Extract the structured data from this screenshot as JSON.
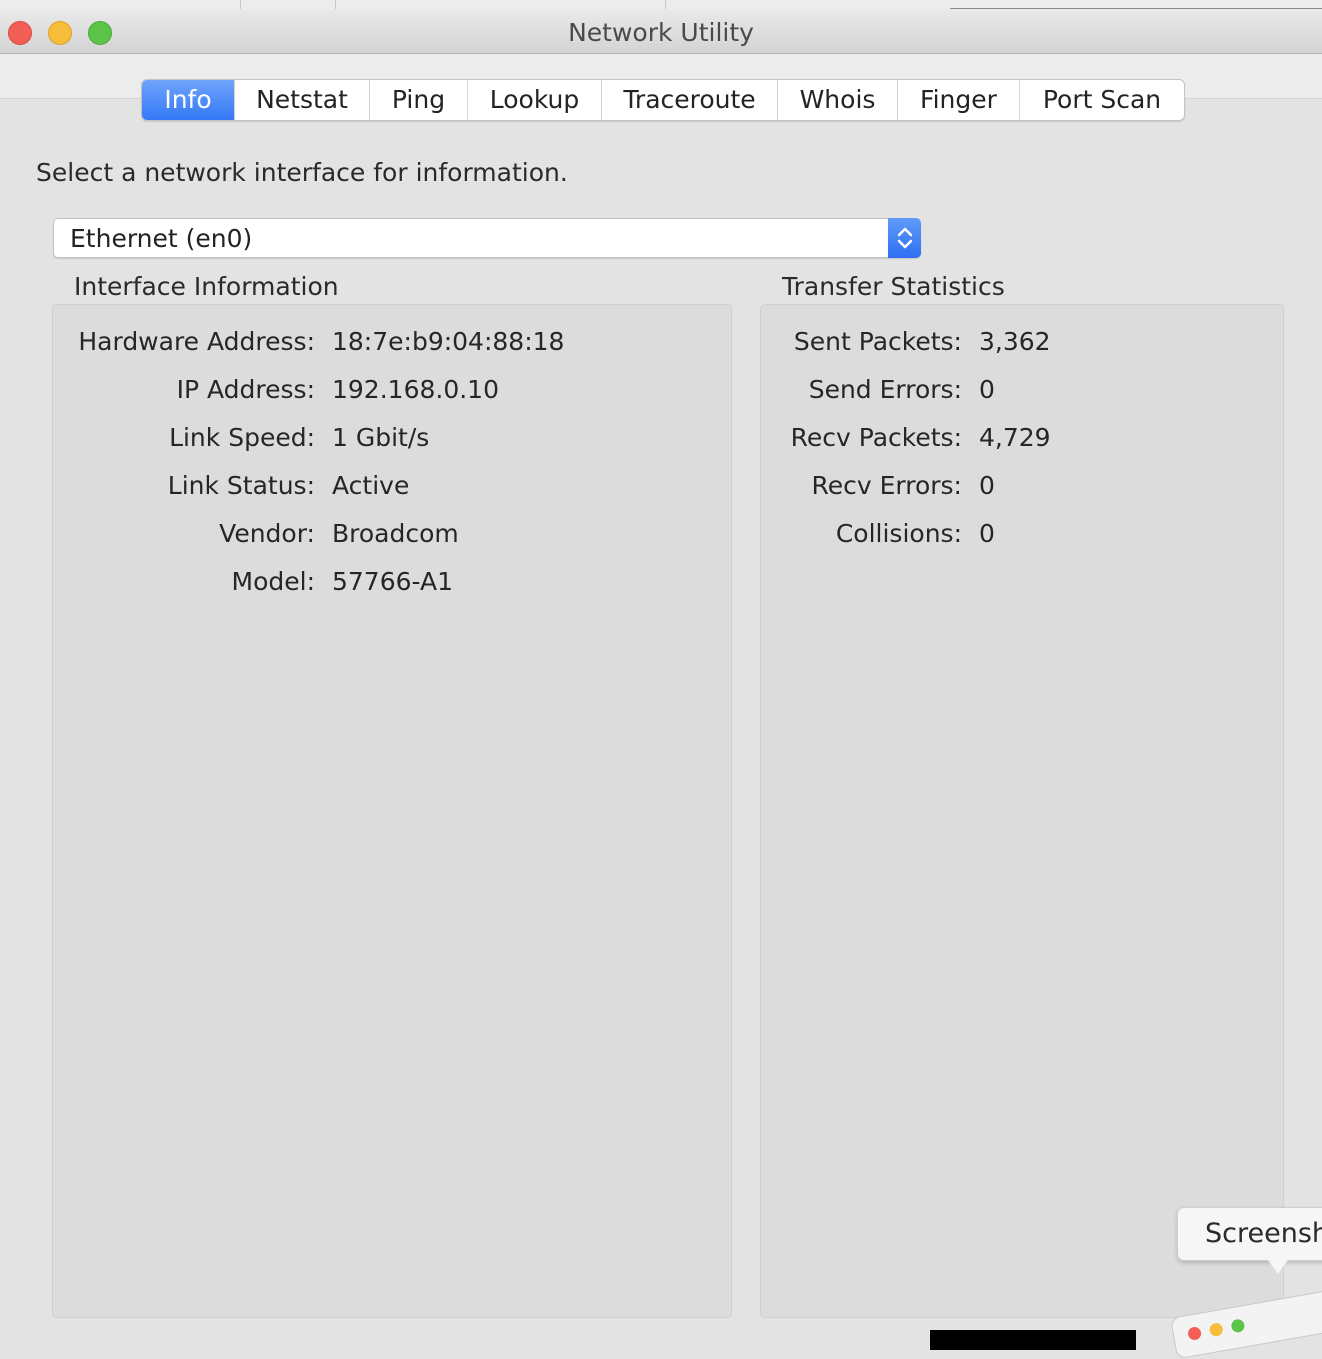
{
  "window": {
    "title": "Network Utility"
  },
  "tabs": [
    {
      "label": "Info",
      "active": true
    },
    {
      "label": "Netstat",
      "active": false
    },
    {
      "label": "Ping",
      "active": false
    },
    {
      "label": "Lookup",
      "active": false
    },
    {
      "label": "Traceroute",
      "active": false
    },
    {
      "label": "Whois",
      "active": false
    },
    {
      "label": "Finger",
      "active": false
    },
    {
      "label": "Port Scan",
      "active": false
    }
  ],
  "info": {
    "instruction": "Select a network interface for information.",
    "interface_select": {
      "selected": "Ethernet (en0)"
    },
    "interface_information": {
      "title": "Interface Information",
      "rows": [
        {
          "label": "Hardware Address:",
          "value": "18:7e:b9:04:88:18"
        },
        {
          "label": "IP Address:",
          "value": "192.168.0.10"
        },
        {
          "label": "Link Speed:",
          "value": "1 Gbit/s"
        },
        {
          "label": "Link Status:",
          "value": "Active"
        },
        {
          "label": "Vendor:",
          "value": "Broadcom"
        },
        {
          "label": "Model:",
          "value": "57766-A1"
        }
      ]
    },
    "transfer_statistics": {
      "title": "Transfer Statistics",
      "rows": [
        {
          "label": "Sent Packets:",
          "value": "3,362"
        },
        {
          "label": "Send Errors:",
          "value": "0"
        },
        {
          "label": "Recv Packets:",
          "value": "4,729"
        },
        {
          "label": "Recv Errors:",
          "value": "0"
        },
        {
          "label": "Collisions:",
          "value": "0"
        }
      ]
    }
  },
  "overlay": {
    "screenshot_tooltip": "Screensh"
  },
  "colors": {
    "accent": "#3478f6",
    "close": "#f25f57",
    "minimize": "#f6bd3b",
    "zoom": "#5dc44a"
  }
}
